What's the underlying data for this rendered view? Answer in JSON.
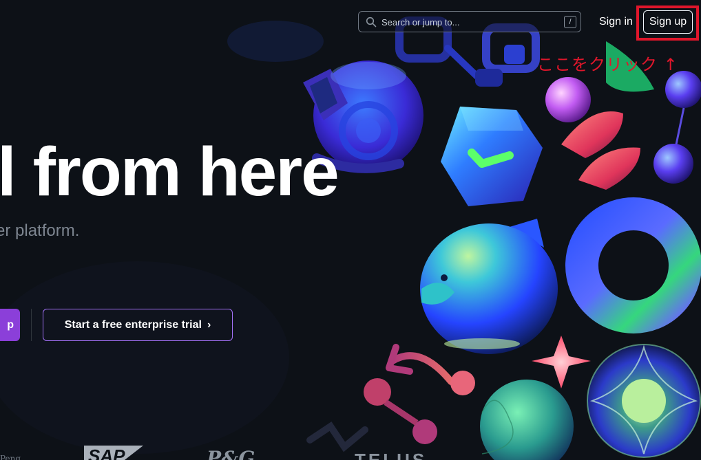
{
  "header": {
    "search_placeholder": "Search or jump to...",
    "search_shortcut": "/",
    "signin_label": "Sign in",
    "signup_label": "Sign up"
  },
  "annotation": {
    "text": "ここをクリック ↑",
    "color": "#e0162b"
  },
  "hero": {
    "title": "l from here",
    "subtitle": "er platform."
  },
  "cta": {
    "primary_partial_label": "p",
    "trial_label": "Start a free enterprise trial",
    "trial_chevron": "›"
  },
  "logos": {
    "partial_left": "Peng",
    "sap": "SAP",
    "pg": "P&G",
    "telus": "TELUS"
  },
  "colors": {
    "background": "#0d1117",
    "accent_purple": "#8b3fd9",
    "border_purple": "#a371f7",
    "annotation_red": "#e0162b"
  }
}
